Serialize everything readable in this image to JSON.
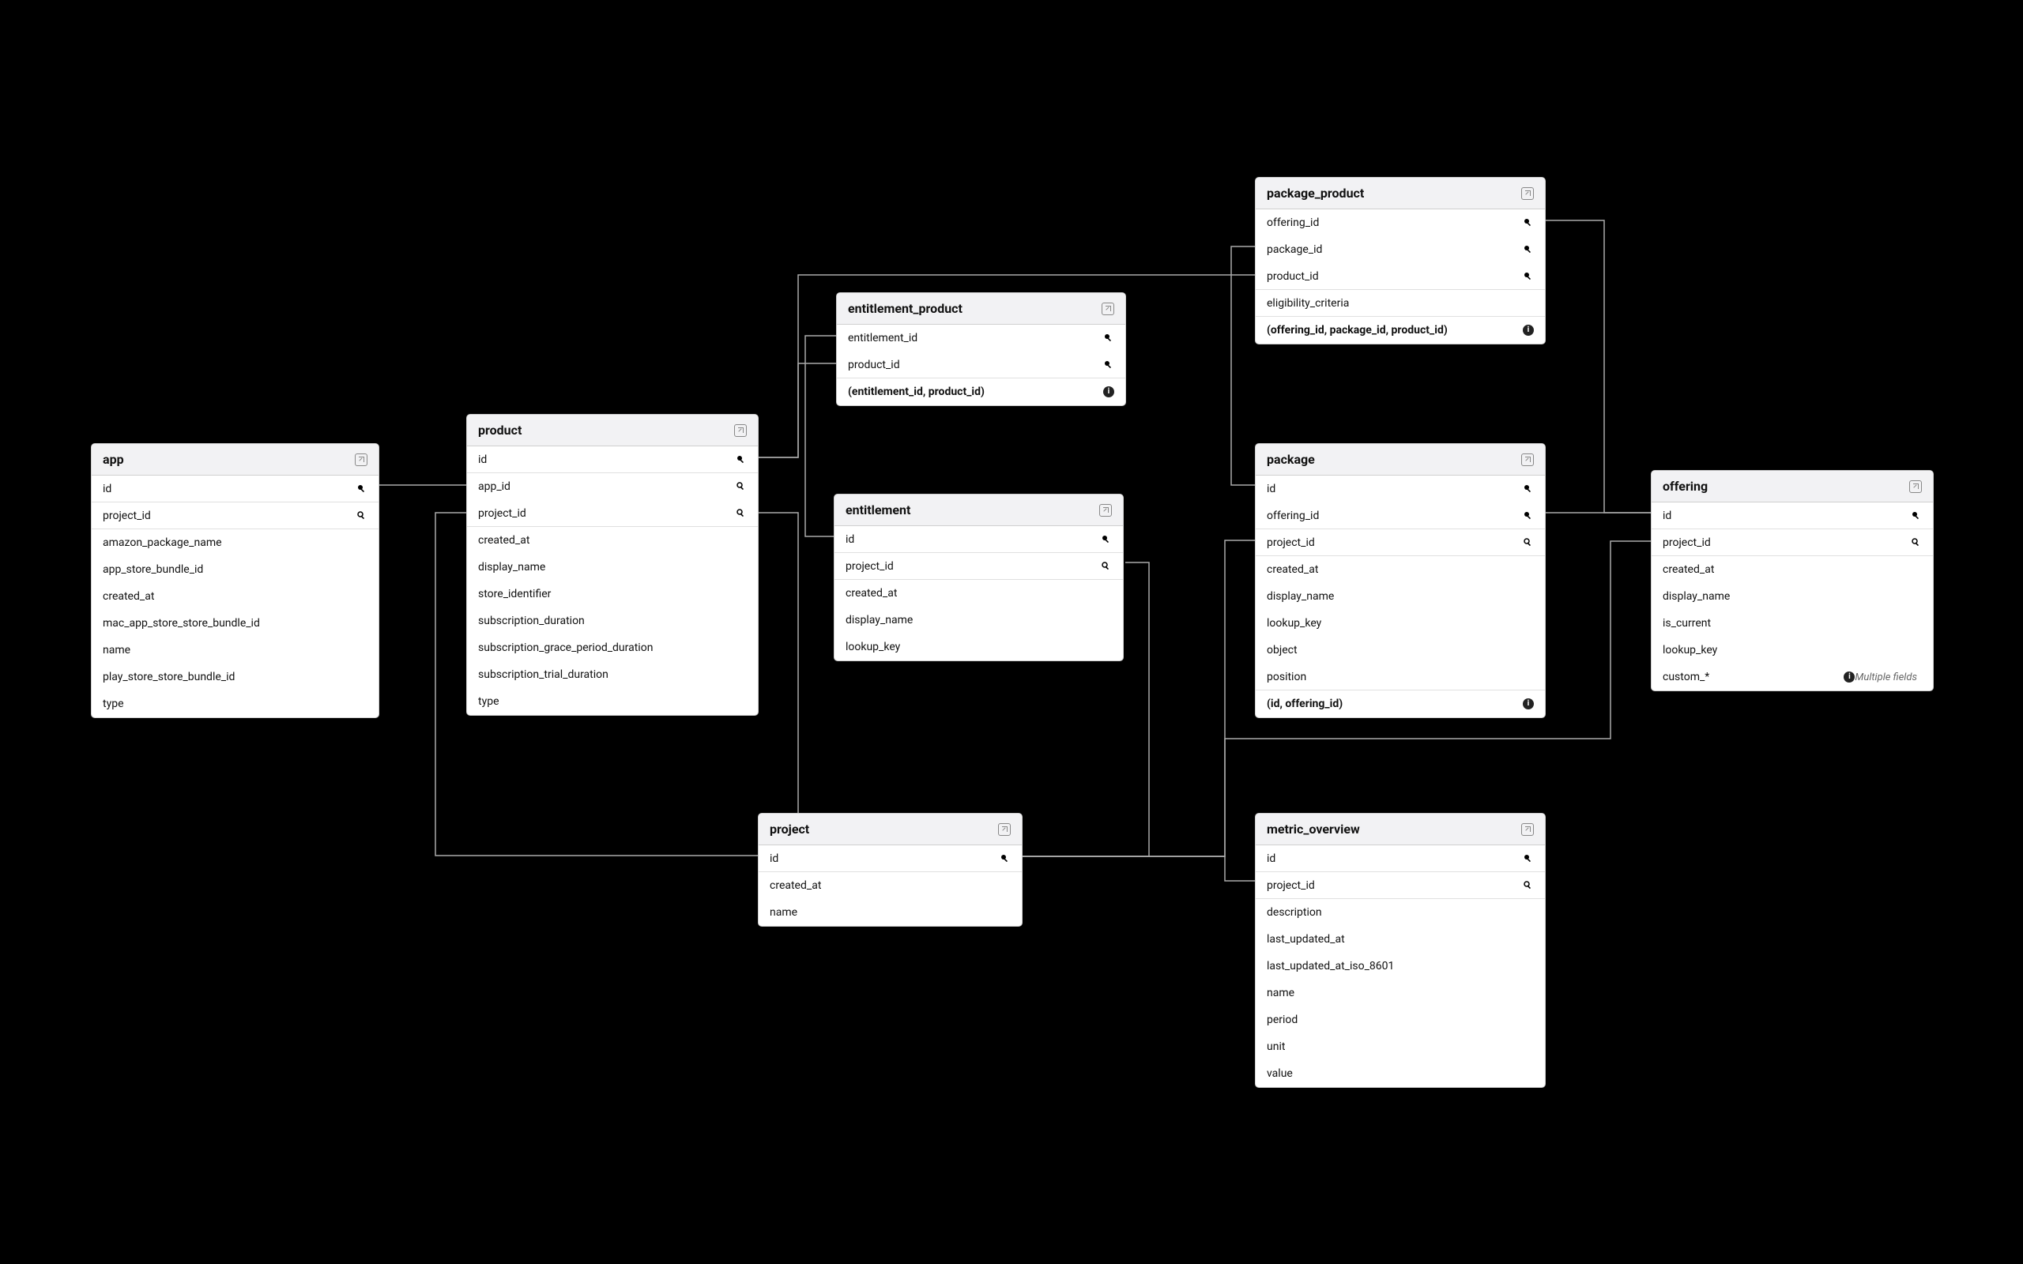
{
  "tables": {
    "app": {
      "title": "app",
      "fields": {
        "id": "id",
        "project_id": "project_id",
        "amazon_package_name": "amazon_package_name",
        "app_store_bundle_id": "app_store_bundle_id",
        "created_at": "created_at",
        "mac_app_store_store_bundle_id": "mac_app_store_store_bundle_id",
        "name": "name",
        "play_store_store_bundle_id": "play_store_store_bundle_id",
        "type": "type"
      }
    },
    "product": {
      "title": "product",
      "fields": {
        "id": "id",
        "app_id": "app_id",
        "project_id": "project_id",
        "created_at": "created_at",
        "display_name": "display_name",
        "store_identifier": "store_identifier",
        "subscription_duration": "subscription_duration",
        "subscription_grace_period_duration": "subscription_grace_period_duration",
        "subscription_trial_duration": "subscription_trial_duration",
        "type": "type"
      }
    },
    "entitlement_product": {
      "title": "entitlement_product",
      "fields": {
        "entitlement_id": "entitlement_id",
        "product_id": "product_id",
        "composite": "(entitlement_id, product_id)"
      }
    },
    "entitlement": {
      "title": "entitlement",
      "fields": {
        "id": "id",
        "project_id": "project_id",
        "created_at": "created_at",
        "display_name": "display_name",
        "lookup_key": "lookup_key"
      }
    },
    "project": {
      "title": "project",
      "fields": {
        "id": "id",
        "created_at": "created_at",
        "name": "name"
      }
    },
    "package_product": {
      "title": "package_product",
      "fields": {
        "offering_id": "offering_id",
        "package_id": "package_id",
        "product_id": "product_id",
        "eligibility_criteria": "eligibility_criteria",
        "composite": "(offering_id, package_id, product_id)"
      }
    },
    "package": {
      "title": "package",
      "fields": {
        "id": "id",
        "offering_id": "offering_id",
        "project_id": "project_id",
        "created_at": "created_at",
        "display_name": "display_name",
        "lookup_key": "lookup_key",
        "object": "object",
        "position": "position",
        "composite": "(id, offering_id)"
      }
    },
    "offering": {
      "title": "offering",
      "fields": {
        "id": "id",
        "project_id": "project_id",
        "created_at": "created_at",
        "display_name": "display_name",
        "is_current": "is_current",
        "lookup_key": "lookup_key",
        "custom": "custom_*"
      },
      "badge": "Multiple fields"
    },
    "metric_overview": {
      "title": "metric_overview",
      "fields": {
        "id": "id",
        "project_id": "project_id",
        "description": "description",
        "last_updated_at": "last_updated_at",
        "last_updated_at_iso_8601": "last_updated_at_iso_8601",
        "name": "name",
        "period": "period",
        "unit": "unit",
        "value": "value"
      }
    }
  },
  "relationships": [
    {
      "from": "app.id",
      "to": "product.app_id"
    },
    {
      "from": "product.id",
      "to": "entitlement_product.product_id"
    },
    {
      "from": "product.id",
      "to": "package_product.product_id"
    },
    {
      "from": "product.project_id",
      "to": "project.id"
    },
    {
      "from": "entitlement.id",
      "to": "entitlement_product.entitlement_id"
    },
    {
      "from": "entitlement.project_id",
      "to": "project.id"
    },
    {
      "from": "project.id",
      "to": "package.project_id"
    },
    {
      "from": "project.id",
      "to": "offering.project_id"
    },
    {
      "from": "project.id",
      "to": "metric_overview.project_id"
    },
    {
      "from": "package.id",
      "to": "package_product.package_id"
    },
    {
      "from": "package.offering_id",
      "to": "offering.id"
    },
    {
      "from": "offering.id",
      "to": "package_product.offering_id"
    }
  ]
}
